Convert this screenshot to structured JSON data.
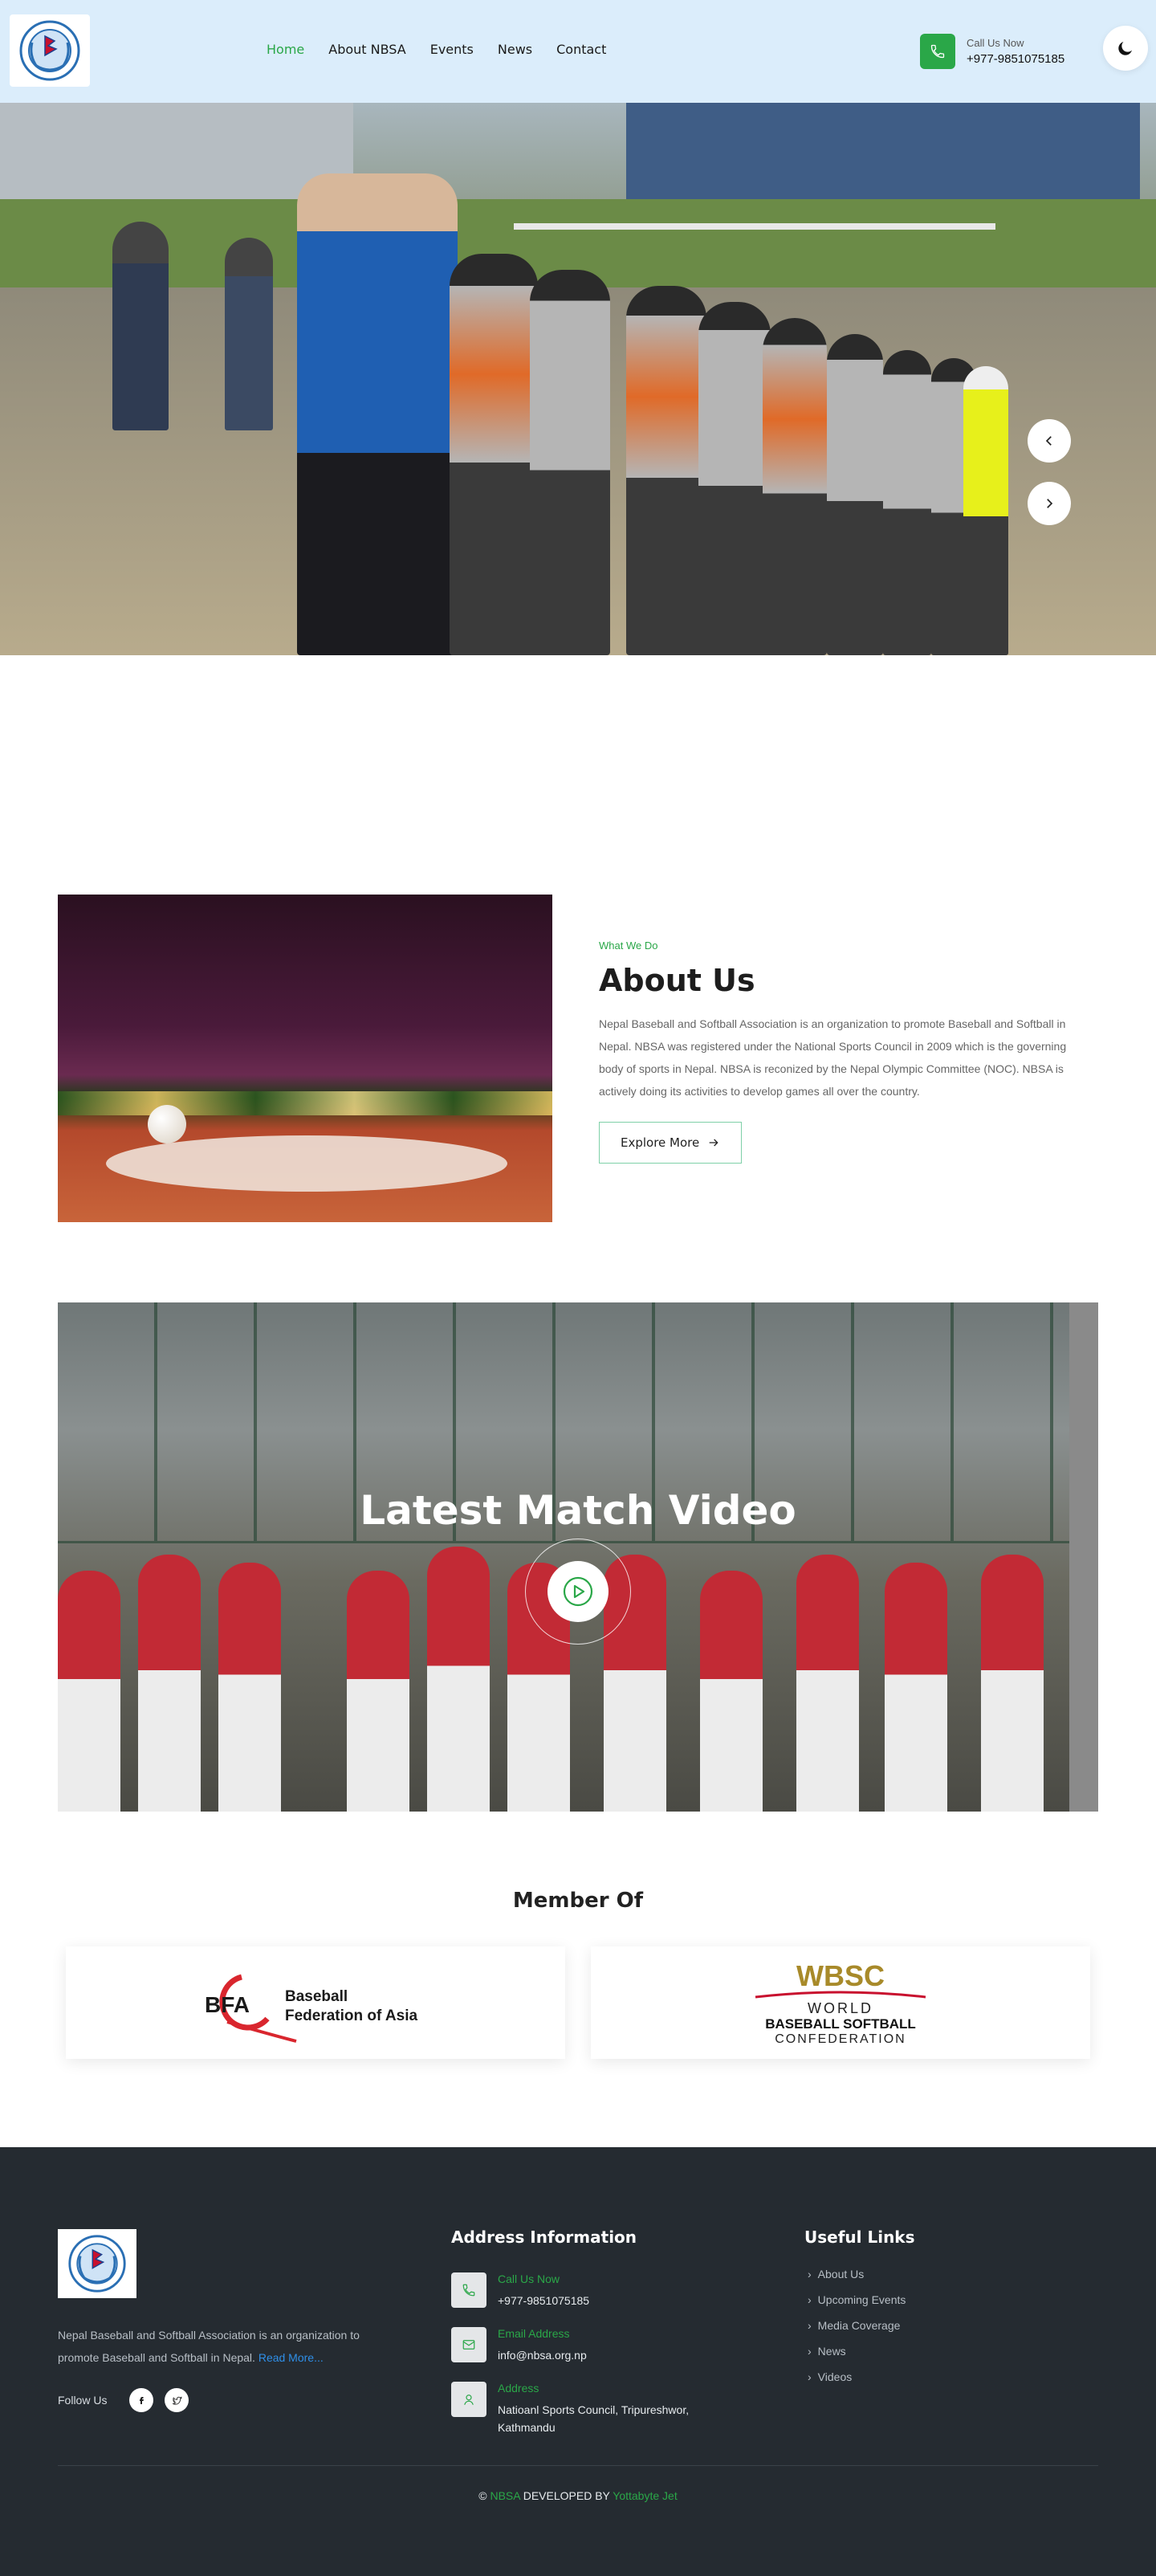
{
  "header": {
    "nav": [
      "Home",
      "About NBSA",
      "Events",
      "News",
      "Contact"
    ],
    "call_label": "Call Us Now",
    "call_number": "+977-9851075185"
  },
  "about": {
    "eyebrow": "What We Do",
    "title": "About Us",
    "description": "Nepal Baseball and Softball Association is an organization to promote Baseball and Softball in Nepal. NBSA was registered under the National Sports Council in 2009 which is the governing body of sports in Nepal. NBSA is reconized by the Nepal Olympic Committee (NOC). NBSA is actively doing its activities to develop games all over the country.",
    "button": "Explore More"
  },
  "video": {
    "title": "Latest Match Video"
  },
  "member": {
    "title": "Member Of",
    "bfa_abbr": "BFA",
    "bfa_line1": "Baseball",
    "bfa_line2": "Federation of Asia",
    "wbsc_abbr": "WBSC",
    "wbsc_line1": "WORLD",
    "wbsc_line2": "BASEBALL SOFTBALL",
    "wbsc_line3": "CONFEDERATION"
  },
  "footer": {
    "about_text": "Nepal Baseball and Softball Association is an organization to promote Baseball and Softball in Nepal.",
    "read_more": "Read More...",
    "follow_label": "Follow Us",
    "address_heading": "Address Information",
    "call_label": "Call Us Now",
    "call_value": "+977-9851075185",
    "email_label": "Email Address",
    "email_value": "info@nbsa.org.np",
    "address_label": "Address",
    "address_value": "Natioanl Sports Council, Tripureshwor, Kathmandu",
    "links_heading": "Useful Links",
    "links": [
      "About Us",
      "Upcoming Events",
      "Media Coverage",
      "News",
      "Videos"
    ],
    "copyright_symbol": "©",
    "copyright_org": "NBSA",
    "copyright_mid": "DEVELOPED BY",
    "copyright_dev": "Yottabyte Jet"
  },
  "colors": {
    "accent": "#2aa748",
    "header_bg": "#dbedfb",
    "footer_bg": "#252b31",
    "link": "#2f8fe8"
  },
  "icons": {
    "phone": "phone-icon",
    "theme": "moon-icon",
    "prev": "chevron-left-icon",
    "next": "chevron-right-icon",
    "arrow": "arrow-right-icon",
    "play": "play-icon",
    "facebook": "facebook-icon",
    "twitter": "twitter-icon",
    "email": "email-icon",
    "address": "location-icon",
    "link": "chevron-right-icon"
  }
}
